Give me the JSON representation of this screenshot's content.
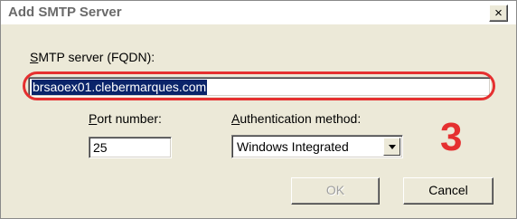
{
  "window": {
    "title": "Add SMTP Server",
    "close_glyph": "×"
  },
  "server": {
    "label_mnemonic": "S",
    "label_rest": "MTP server (FQDN):",
    "value": "brsaoex01.clebermarques.com"
  },
  "port": {
    "label_mnemonic": "P",
    "label_rest": "ort number:",
    "value": "25"
  },
  "auth": {
    "label_mnemonic": "A",
    "label_rest": "uthentication method:",
    "selected": "Windows Integrated"
  },
  "annotation": {
    "step": "3",
    "color": "#e53030"
  },
  "buttons": {
    "ok": "OK",
    "cancel": "Cancel"
  },
  "colors": {
    "selection": "#0a246a",
    "dialog_bg": "#ece9d8"
  }
}
